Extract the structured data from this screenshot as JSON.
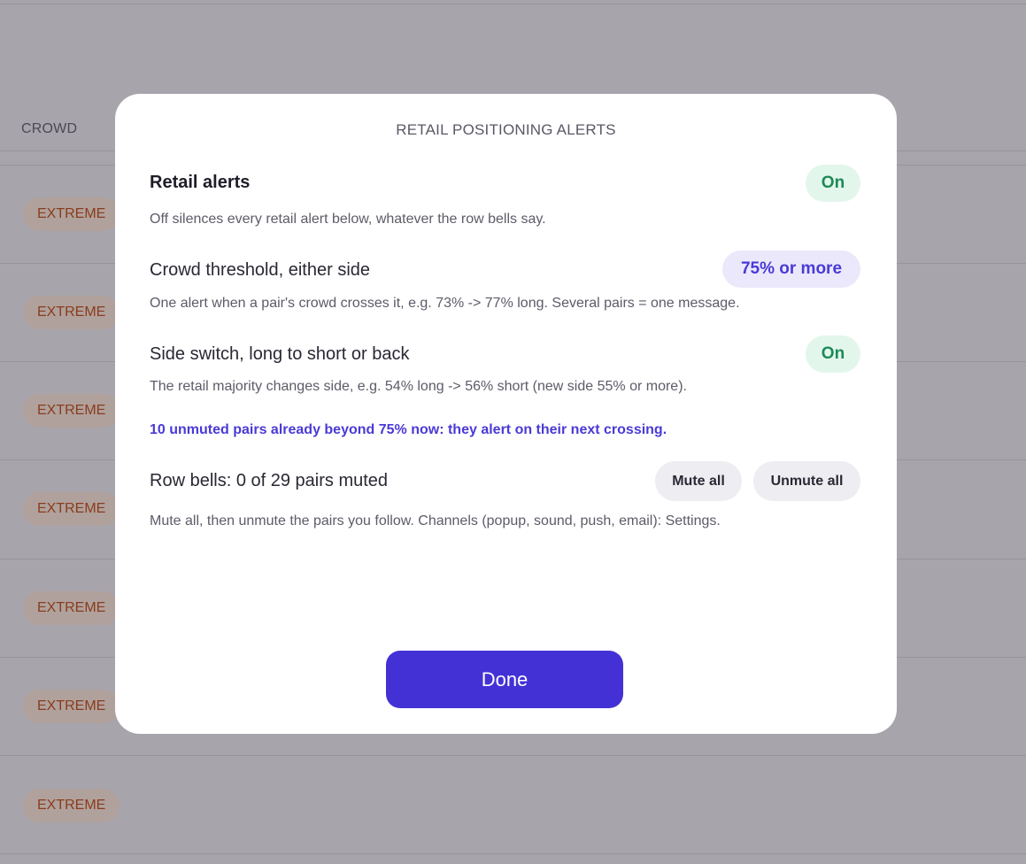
{
  "background": {
    "column_header": "CROWD",
    "badges": [
      "EXTREME",
      "EXTREME",
      "EXTREME",
      "EXTREME",
      "EXTREME",
      "EXTREME",
      "EXTREME"
    ]
  },
  "modal": {
    "title": "RETAIL POSITIONING ALERTS",
    "retail_alerts": {
      "label": "Retail alerts",
      "state": "On",
      "description": "Off silences every retail alert below, whatever the row bells say."
    },
    "crowd_threshold": {
      "label": "Crowd threshold, either side",
      "value": "75% or more",
      "description": "One alert when a pair's crowd crosses it, e.g. 73% -> 77% long. Several pairs = one message."
    },
    "side_switch": {
      "label": "Side switch, long to short or back",
      "state": "On",
      "description": "The retail majority changes side, e.g. 54% long -> 56% short (new side 55% or more)."
    },
    "note": "10 unmuted pairs already beyond 75% now: they alert on their next crossing.",
    "row_bells": {
      "label": "Row bells: 0 of 29 pairs muted",
      "mute_all": "Mute all",
      "unmute_all": "Unmute all",
      "description": "Mute all, then unmute the pairs you follow. Channels (popup, sound, push, email): Settings."
    },
    "done_label": "Done"
  },
  "colors": {
    "accent": "#4331d6",
    "on_green": "#1d8a57",
    "on_green_bg": "#e3f6ec",
    "badge_text": "#8a3c1c"
  }
}
